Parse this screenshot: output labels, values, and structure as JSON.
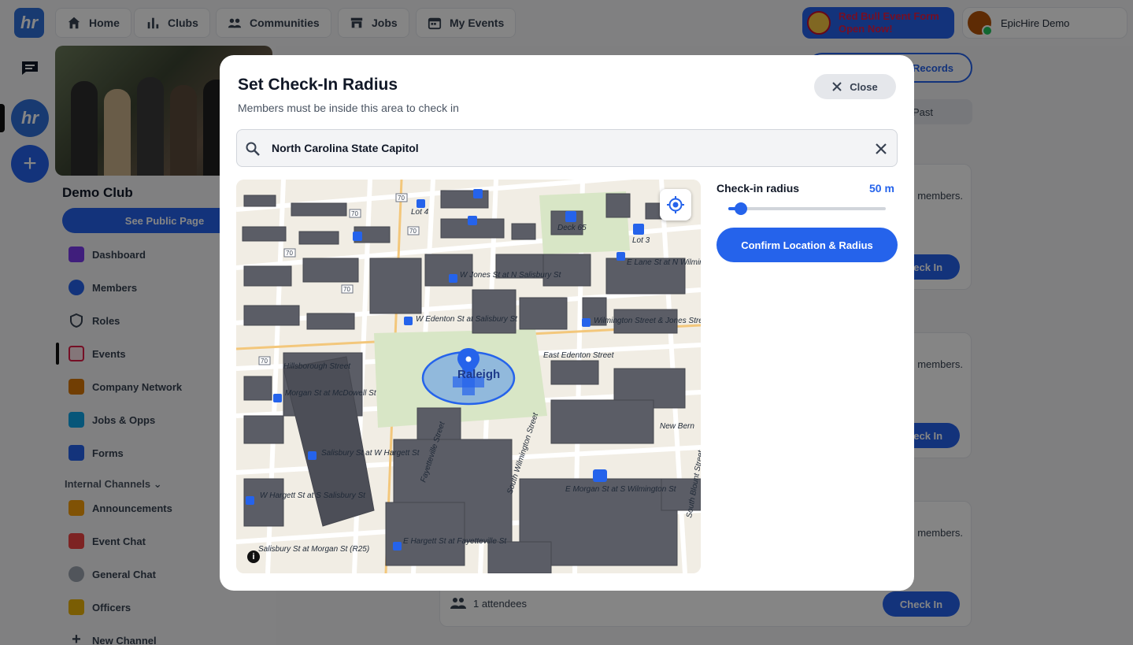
{
  "topbar": {
    "logo_text": "hr",
    "tabs": [
      {
        "label": "Home",
        "icon": "home-icon"
      },
      {
        "label": "Clubs",
        "icon": "bar-chart-icon"
      },
      {
        "label": "Communities",
        "icon": "people-icon"
      },
      {
        "label": "Jobs",
        "icon": "store-icon"
      },
      {
        "label": "My Events",
        "icon": "calendar-icon"
      }
    ],
    "promo": {
      "line1": "Red Bull Event Form",
      "line2": "Open Now!"
    },
    "user": {
      "name": "EpicHire Demo"
    }
  },
  "rail": {
    "club_text": "hr",
    "add_text": "+"
  },
  "sidebar": {
    "club_name": "Demo Club",
    "public_button": "See Public Page",
    "items": [
      {
        "label": "Dashboard",
        "color": "#7c3aed"
      },
      {
        "label": "Members",
        "color": "#2563eb"
      },
      {
        "label": "Roles",
        "color": "#374151"
      },
      {
        "label": "Events",
        "color": "#e11d48"
      },
      {
        "label": "Company Network",
        "color": "#d97706"
      },
      {
        "label": "Jobs & Opps",
        "color": "#0ea5e9"
      },
      {
        "label": "Forms",
        "color": "#2563eb"
      }
    ],
    "section_label": "Internal Channels",
    "channels": [
      {
        "label": "Announcements",
        "color": "#f59e0b"
      },
      {
        "label": "Event Chat",
        "color": "#ef4444"
      },
      {
        "label": "General Chat",
        "color": "#9ca3af"
      },
      {
        "label": "Officers",
        "color": "#eab308"
      },
      {
        "label": "New Channel",
        "color": "#374151"
      }
    ]
  },
  "main": {
    "records_button": "Records",
    "past_tab": "Past",
    "members_text": "members.",
    "checkin_label": "Check In",
    "attendees_text": "1 attendees"
  },
  "modal": {
    "title": "Set Check-In Radius",
    "subtitle": "Members must be inside this area to check in",
    "close_label": "Close",
    "search_value": "North Carolina State Capitol",
    "map_labels": {
      "raleigh": "Raleigh",
      "lot4": "Lot 4",
      "deck65": "Deck 65",
      "lot3": "Lot 3",
      "e_lane": "E Lane St at N Wilmington St",
      "w_jones": "W Jones St at N Salisbury St",
      "w_edenton": "W Edenton St at Salisbury St",
      "wilmington_jones": "Wilmington Street & Jones Street",
      "e_edenton": "East Edenton Street",
      "hillsborough": "Hillsborough Street",
      "morgan_mcdowell": "Morgan St at McDowell St",
      "salisbury_hargett": "Salisbury St at W Hargett St",
      "w_hargett_salisbury": "W Hargett St at S Salisbury St",
      "salisbury_morgan": "Salisbury St at Morgan St (R25)",
      "e_hargett_fayetteville": "E Hargett St at Fayetteville St",
      "e_morgan_wilmington": "E Morgan St at S Wilmington St",
      "new_bern": "New Bern",
      "fayetteville": "Fayetteville Street",
      "s_wilmington": "South Wilmington Street",
      "s_blount": "South Blount Street",
      "route70": "70"
    },
    "info_label": "i",
    "radius_label": "Check-in radius",
    "radius_value": "50 m",
    "radius_fraction": 0.08,
    "confirm_label": "Confirm Location & Radius"
  }
}
